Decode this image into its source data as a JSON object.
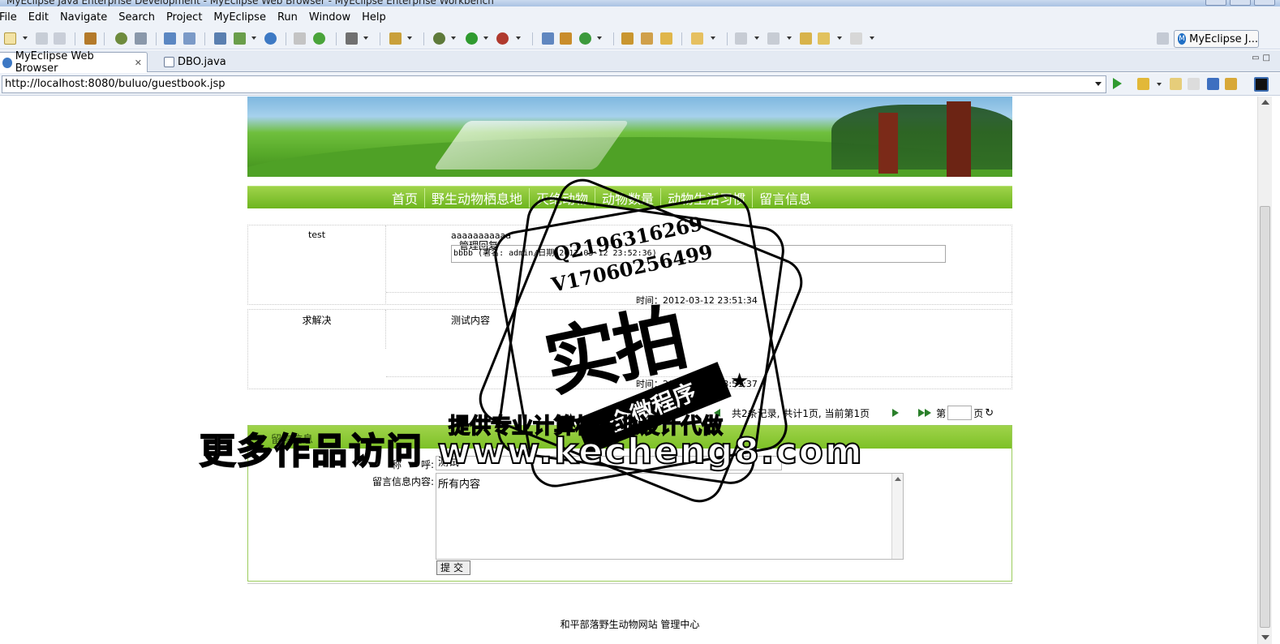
{
  "window": {
    "title": "MyEclipse Java Enterprise Development - MyEclipse Web Browser - MyEclipse Enterprise Workbench"
  },
  "menu": [
    "File",
    "Edit",
    "Navigate",
    "Search",
    "Project",
    "MyEclipse",
    "Run",
    "Window",
    "Help"
  ],
  "perspective": {
    "label": "MyEclipse J..."
  },
  "tabs": [
    {
      "label": "MyEclipse Web Browser",
      "active": true
    },
    {
      "label": "DBO.java",
      "active": false
    }
  ],
  "address": {
    "url": "http://localhost:8080/buluo/guestbook.jsp"
  },
  "site": {
    "nav": [
      "首页",
      "野生动物栖息地",
      "灭绝动物",
      "动物数量",
      "动物生活习惯",
      "留言信息"
    ],
    "messages": [
      {
        "name": "test",
        "content": "aaaaaaaaaaa",
        "reply_label": "管理回复",
        "reply": "bbbb (署名: admin/日期:2012-03-12 23:52:36)",
        "time": "时间：2012-03-12 23:51:34"
      },
      {
        "name": "求解决",
        "content": "测试内容",
        "time": "时间：2012-03-12 23:51:37"
      }
    ],
    "pager": {
      "summary": "共2条记录, 共计1页, 当前第1页",
      "page_prefix": "第",
      "page_suffix": "页"
    },
    "form": {
      "title": "留言信息",
      "name_label": "称　　呼:",
      "name_value": "测试",
      "content_label": "留言信息内容:",
      "content_value": "所有内容",
      "submit_label": "提交"
    },
    "footer": "和平部落野生动物网站 管理中心"
  },
  "watermark": {
    "qq": "Q2196316269",
    "wx": "V17060256499",
    "stamp_big": "实拍",
    "stamp_ribbon": "全微程序",
    "line1": "更多作品访问 www.kecheng8.com",
    "line2": "提供专业计算机毕业设计代做"
  },
  "colors": {
    "nav_green": "#7dc127",
    "chrome": "#eef2f8"
  }
}
